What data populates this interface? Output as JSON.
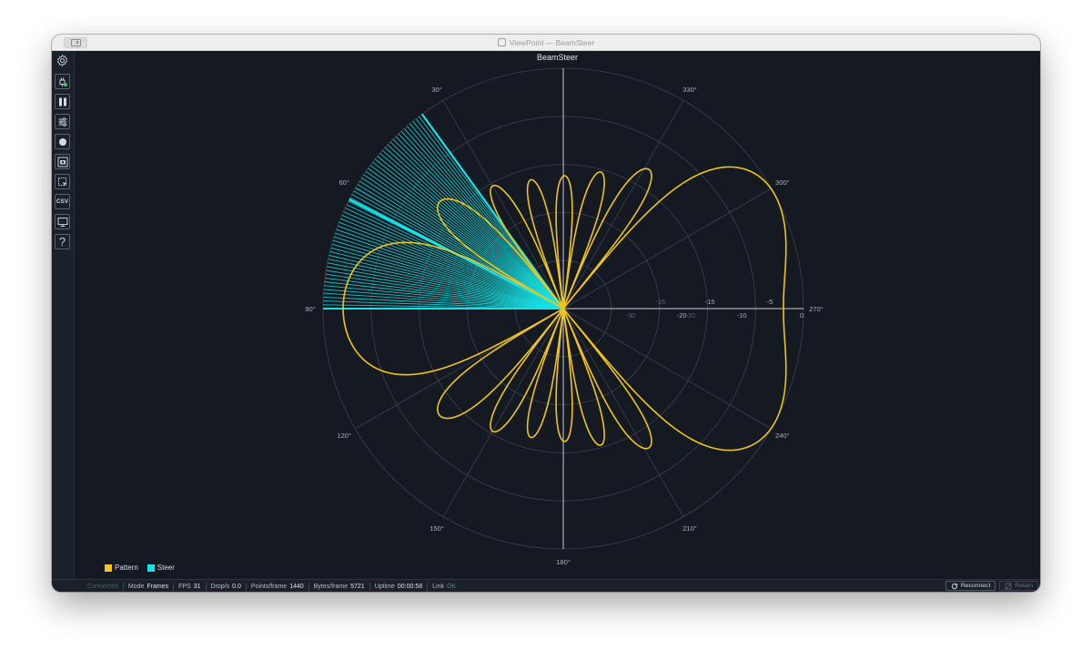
{
  "window": {
    "title": "ViewPoint — BeamSteer"
  },
  "toolbar": {
    "csv_label": "CSV",
    "help_label": "?"
  },
  "chart_data": {
    "type": "polar",
    "title": "BeamSteer",
    "theta_direction": "counterclockwise",
    "theta_zero": "top",
    "angle_labels": [
      "180°",
      "150°",
      "120°",
      "90°",
      "60°",
      "30°",
      "330°",
      "300°",
      "270°",
      "240°",
      "210°"
    ],
    "radial_axis": {
      "range": [
        -40,
        0
      ],
      "tick_labels": [
        "-20",
        "-10",
        "0"
      ],
      "minor_tick_labels": [
        "-15",
        "-5"
      ],
      "inner_tick_labels": [
        "-30",
        "-25",
        "-20"
      ]
    },
    "series": [
      {
        "name": "Pattern",
        "color": "#f0c419",
        "steer_center_deg": -62,
        "array_elements": 8,
        "floor_db": -40
      },
      {
        "name": "Steer",
        "color": "#17e3e6",
        "theta_range_deg": [
          36,
          90
        ],
        "line_count": 60,
        "highlight_theta_deg": 63
      }
    ],
    "legend": [
      "Pattern",
      "Steer"
    ],
    "legend_position": "bottom-left",
    "grid": true
  },
  "statusbar": {
    "connection": "Connected",
    "mode_label": "Mode",
    "mode_value": "Frames",
    "fps_label": "FPS",
    "fps_value": "31",
    "drops_label": "Drop/s",
    "drops_value": "0.0",
    "points_label": "Points/frame",
    "points_value": "1440",
    "bytes_label": "Bytes/frame",
    "bytes_value": "5721",
    "uptime_label": "Uptime",
    "uptime_value": "00:00:58",
    "link_label": "Link",
    "link_value": "OK",
    "reconnect_label": "Reconnect",
    "retain_label": "Retain"
  }
}
